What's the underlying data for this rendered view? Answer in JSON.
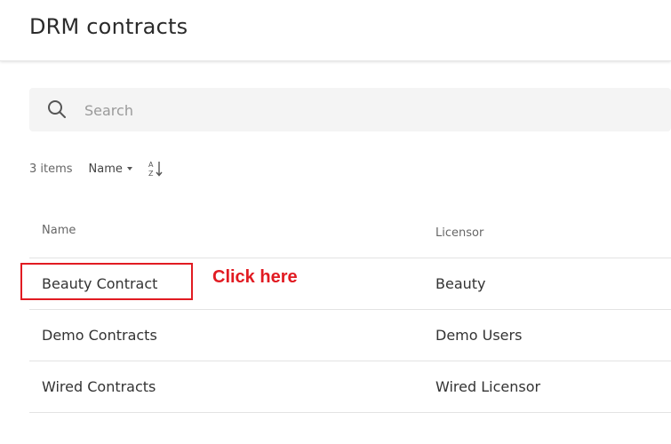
{
  "header": {
    "title": "DRM contracts"
  },
  "search": {
    "placeholder": "Search",
    "value": "",
    "icon": "search-icon"
  },
  "toolbar": {
    "items_count": "3 items",
    "sort_by_label": "Name",
    "sort_icon": "sort-a-z-icon"
  },
  "table": {
    "columns": [
      "Name",
      "Licensor"
    ],
    "rows": [
      {
        "name": "Beauty Contract",
        "licensor": "Beauty"
      },
      {
        "name": "Demo Contracts",
        "licensor": "Demo Users"
      },
      {
        "name": "Wired Contracts",
        "licensor": "Wired Licensor"
      }
    ]
  },
  "annotation": {
    "callout_text": "Click here",
    "color": "#e11b22"
  }
}
